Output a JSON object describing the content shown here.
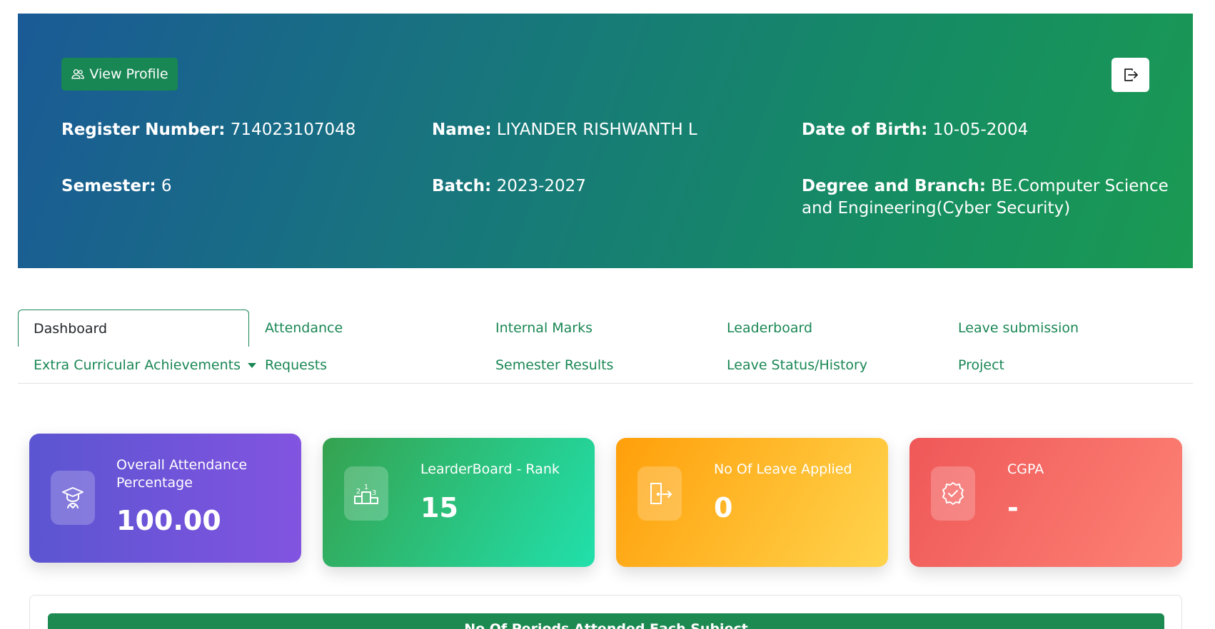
{
  "header": {
    "view_profile_label": "View Profile",
    "fields": {
      "register_number": {
        "label": "Register Number:",
        "value": " 714023107048"
      },
      "name": {
        "label": "Name:",
        "value": " LIYANDER RISHWANTH L"
      },
      "dob": {
        "label": "Date of Birth:",
        "value": " 10-05-2004"
      },
      "semester": {
        "label": "Semester:",
        "value": " 6"
      },
      "batch": {
        "label": "Batch:",
        "value": " 2023-2027"
      },
      "degree": {
        "label": "Degree and Branch:",
        "value": " BE.Computer Science and Engineering(Cyber Security)"
      }
    }
  },
  "tabs": {
    "dashboard": "Dashboard",
    "attendance": "Attendance",
    "internal_marks": "Internal Marks",
    "leaderboard": "Leaderboard",
    "leave_submission": "Leave submission",
    "extra_curricular": "Extra Curricular Achievements",
    "requests": "Requests",
    "semester_results": "Semester Results",
    "leave_status": "Leave Status/History",
    "project": "Project"
  },
  "cards": {
    "attendance": {
      "label": "Overall Attendance Percentage",
      "value": "100.00",
      "icon": "graduate-icon"
    },
    "rank": {
      "label": "LearderBoard - Rank",
      "value": "15",
      "icon": "podium-icon"
    },
    "leave": {
      "label": "No Of Leave Applied",
      "value": "0",
      "icon": "door-exit-icon"
    },
    "cgpa": {
      "label": "CGPA",
      "value": "-",
      "icon": "badge-check-icon"
    }
  },
  "panel": {
    "title": "No Of Periods Attended Each Subject"
  },
  "colors": {
    "primary_green": "#198754",
    "card_attendance": "#6c55d8",
    "card_rank": "#2bc27c",
    "card_leave": "#ffb72a",
    "card_cgpa": "#f66a62"
  }
}
